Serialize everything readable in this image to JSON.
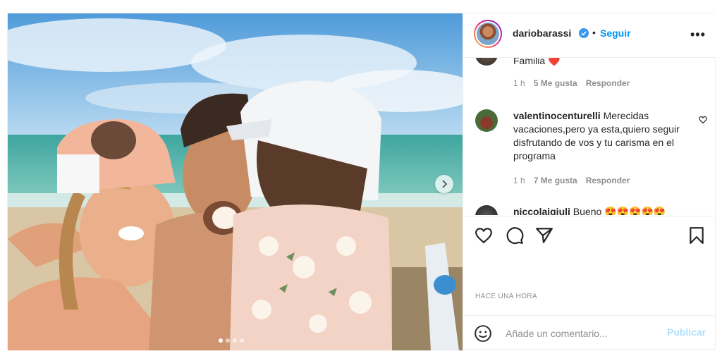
{
  "post": {
    "author": {
      "username": "dariobarassi",
      "verified": true,
      "follow_label": "Seguir",
      "separator": "•"
    },
    "carousel": {
      "total_slides": 4,
      "active_slide": 1
    },
    "comments": [
      {
        "username": "",
        "text": "Familia ❤️",
        "time": "1 h",
        "likes": "5 Me gusta",
        "reply": "Responder"
      },
      {
        "username": "valentinocenturelli",
        "text": "Merecidas vacaciones,pero ya esta,quiero seguir disfrutando de vos y tu carisma en el programa",
        "time": "1 h",
        "likes": "7 Me gusta",
        "reply": "Responder"
      },
      {
        "username": "niccolaigiuli",
        "text": "Bueno 😍😍😍😍😍"
      }
    ],
    "timestamp": "HACE UNA HORA",
    "add_comment": {
      "placeholder": "Añade un comentario...",
      "publish_label": "Publicar"
    },
    "icons": {
      "like": "heart-icon",
      "comment": "comment-icon",
      "share": "paper-plane-icon",
      "save": "bookmark-icon",
      "emoji": "smiley-icon",
      "more": "more-options-icon",
      "next": "chevron-right-icon"
    },
    "colors": {
      "link": "#0095f6",
      "publish_disabled": "#b2dffc",
      "muted": "#8e8e8e",
      "text": "#262626"
    }
  }
}
